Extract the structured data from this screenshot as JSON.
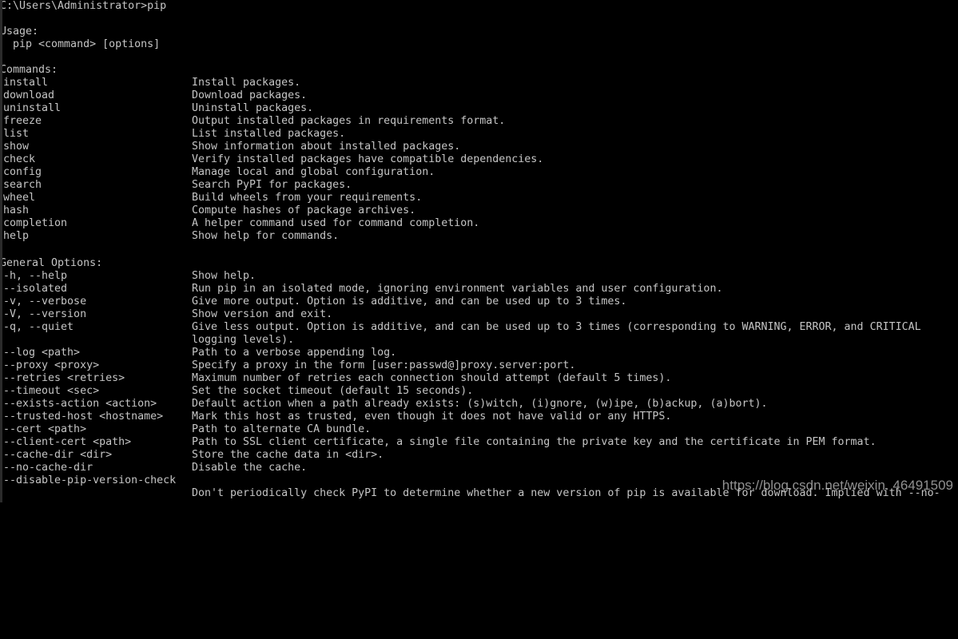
{
  "terminal": {
    "background_color": "#000000",
    "text_color": "#c5c5c5",
    "prompt_line": "C:\\Users\\Administrator>pip",
    "usage_heading": "Usage:",
    "usage_line": "  pip <command> [options]",
    "commands_heading": "Commands:",
    "general_options_heading": "General Options:"
  },
  "commands": [
    {
      "name": "install",
      "description": "Install packages."
    },
    {
      "name": "download",
      "description": "Download packages."
    },
    {
      "name": "uninstall",
      "description": "Uninstall packages."
    },
    {
      "name": "freeze",
      "description": "Output installed packages in requirements format."
    },
    {
      "name": "list",
      "description": "List installed packages."
    },
    {
      "name": "show",
      "description": "Show information about installed packages."
    },
    {
      "name": "check",
      "description": "Verify installed packages have compatible dependencies."
    },
    {
      "name": "config",
      "description": "Manage local and global configuration."
    },
    {
      "name": "search",
      "description": "Search PyPI for packages."
    },
    {
      "name": "wheel",
      "description": "Build wheels from your requirements."
    },
    {
      "name": "hash",
      "description": "Compute hashes of package archives."
    },
    {
      "name": "completion",
      "description": "A helper command used for command completion."
    },
    {
      "name": "help",
      "description": "Show help for commands."
    }
  ],
  "general_options": [
    {
      "flag": "-h, --help",
      "description": "Show help.",
      "continuation": ""
    },
    {
      "flag": "--isolated",
      "description": "Run pip in an isolated mode, ignoring environment variables and user configuration.",
      "continuation": ""
    },
    {
      "flag": "-v, --verbose",
      "description": "Give more output. Option is additive, and can be used up to 3 times.",
      "continuation": ""
    },
    {
      "flag": "-V, --version",
      "description": "Show version and exit.",
      "continuation": ""
    },
    {
      "flag": "-q, --quiet",
      "description": "Give less output. Option is additive, and can be used up to 3 times (corresponding to WARNING, ERROR, and CRITICAL",
      "continuation": "logging levels)."
    },
    {
      "flag": "--log <path>",
      "description": "Path to a verbose appending log.",
      "continuation": ""
    },
    {
      "flag": "--proxy <proxy>",
      "description": "Specify a proxy in the form [user:passwd@]proxy.server:port.",
      "continuation": ""
    },
    {
      "flag": "--retries <retries>",
      "description": "Maximum number of retries each connection should attempt (default 5 times).",
      "continuation": ""
    },
    {
      "flag": "--timeout <sec>",
      "description": "Set the socket timeout (default 15 seconds).",
      "continuation": ""
    },
    {
      "flag": "--exists-action <action>",
      "description": "Default action when a path already exists: (s)witch, (i)gnore, (w)ipe, (b)ackup, (a)bort).",
      "continuation": ""
    },
    {
      "flag": "--trusted-host <hostname>",
      "description": "Mark this host as trusted, even though it does not have valid or any HTTPS.",
      "continuation": ""
    },
    {
      "flag": "--cert <path>",
      "description": "Path to alternate CA bundle.",
      "continuation": ""
    },
    {
      "flag": "--client-cert <path>",
      "description": "Path to SSL client certificate, a single file containing the private key and the certificate in PEM format.",
      "continuation": ""
    },
    {
      "flag": "--cache-dir <dir>",
      "description": "Store the cache data in <dir>.",
      "continuation": ""
    },
    {
      "flag": "--no-cache-dir",
      "description": "Disable the cache.",
      "continuation": ""
    },
    {
      "flag": "--disable-pip-version-check",
      "description": "",
      "continuation": "Don't periodically check PyPI to determine whether a new version of pip is available for download. Implied with --no-"
    }
  ],
  "watermark": {
    "text": "https://blog.csdn.net/weixin. 46491509",
    "color": "#c8c8c8"
  }
}
